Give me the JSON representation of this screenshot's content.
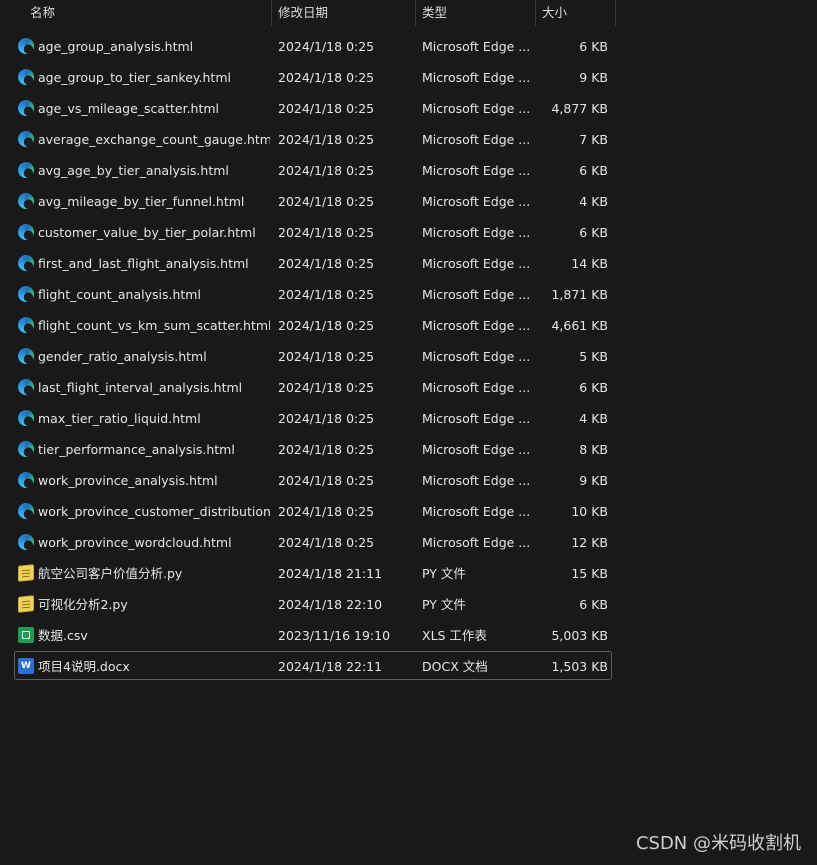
{
  "header": {
    "name": "名称",
    "date": "修改日期",
    "type": "类型",
    "size": "大小",
    "sort_indicator": "⌃"
  },
  "files": [
    {
      "name": "age_group_analysis.html",
      "date": "2024/1/18 0:25",
      "type": "Microsoft Edge ...",
      "size": "6 KB",
      "icon": "edge-icon"
    },
    {
      "name": "age_group_to_tier_sankey.html",
      "date": "2024/1/18 0:25",
      "type": "Microsoft Edge ...",
      "size": "9 KB",
      "icon": "edge-icon"
    },
    {
      "name": "age_vs_mileage_scatter.html",
      "date": "2024/1/18 0:25",
      "type": "Microsoft Edge ...",
      "size": "4,877 KB",
      "icon": "edge-icon"
    },
    {
      "name": "average_exchange_count_gauge.html",
      "date": "2024/1/18 0:25",
      "type": "Microsoft Edge ...",
      "size": "7 KB",
      "icon": "edge-icon"
    },
    {
      "name": "avg_age_by_tier_analysis.html",
      "date": "2024/1/18 0:25",
      "type": "Microsoft Edge ...",
      "size": "6 KB",
      "icon": "edge-icon"
    },
    {
      "name": "avg_mileage_by_tier_funnel.html",
      "date": "2024/1/18 0:25",
      "type": "Microsoft Edge ...",
      "size": "4 KB",
      "icon": "edge-icon"
    },
    {
      "name": "customer_value_by_tier_polar.html",
      "date": "2024/1/18 0:25",
      "type": "Microsoft Edge ...",
      "size": "6 KB",
      "icon": "edge-icon"
    },
    {
      "name": "first_and_last_flight_analysis.html",
      "date": "2024/1/18 0:25",
      "type": "Microsoft Edge ...",
      "size": "14 KB",
      "icon": "edge-icon"
    },
    {
      "name": "flight_count_analysis.html",
      "date": "2024/1/18 0:25",
      "type": "Microsoft Edge ...",
      "size": "1,871 KB",
      "icon": "edge-icon"
    },
    {
      "name": "flight_count_vs_km_sum_scatter.html",
      "date": "2024/1/18 0:25",
      "type": "Microsoft Edge ...",
      "size": "4,661 KB",
      "icon": "edge-icon"
    },
    {
      "name": "gender_ratio_analysis.html",
      "date": "2024/1/18 0:25",
      "type": "Microsoft Edge ...",
      "size": "5 KB",
      "icon": "edge-icon"
    },
    {
      "name": "last_flight_interval_analysis.html",
      "date": "2024/1/18 0:25",
      "type": "Microsoft Edge ...",
      "size": "6 KB",
      "icon": "edge-icon"
    },
    {
      "name": "max_tier_ratio_liquid.html",
      "date": "2024/1/18 0:25",
      "type": "Microsoft Edge ...",
      "size": "4 KB",
      "icon": "edge-icon"
    },
    {
      "name": "tier_performance_analysis.html",
      "date": "2024/1/18 0:25",
      "type": "Microsoft Edge ...",
      "size": "8 KB",
      "icon": "edge-icon"
    },
    {
      "name": "work_province_analysis.html",
      "date": "2024/1/18 0:25",
      "type": "Microsoft Edge ...",
      "size": "9 KB",
      "icon": "edge-icon"
    },
    {
      "name": "work_province_customer_distribution....",
      "date": "2024/1/18 0:25",
      "type": "Microsoft Edge ...",
      "size": "10 KB",
      "icon": "edge-icon"
    },
    {
      "name": "work_province_wordcloud.html",
      "date": "2024/1/18 0:25",
      "type": "Microsoft Edge ...",
      "size": "12 KB",
      "icon": "edge-icon"
    },
    {
      "name": "航空公司客户价值分析.py",
      "date": "2024/1/18 21:11",
      "type": "PY 文件",
      "size": "15 KB",
      "icon": "python-file-icon"
    },
    {
      "name": "可视化分析2.py",
      "date": "2024/1/18 22:10",
      "type": "PY 文件",
      "size": "6 KB",
      "icon": "python-file-icon"
    },
    {
      "name": "数据.csv",
      "date": "2023/11/16 19:10",
      "type": "XLS 工作表",
      "size": "5,003 KB",
      "icon": "excel-file-icon"
    },
    {
      "name": "项目4说明.docx",
      "date": "2024/1/18 22:11",
      "type": "DOCX 文档",
      "size": "1,503 KB",
      "icon": "word-file-icon",
      "selected": true
    }
  ],
  "watermark": "CSDN @米码收割机",
  "word_icon_letter": "W"
}
